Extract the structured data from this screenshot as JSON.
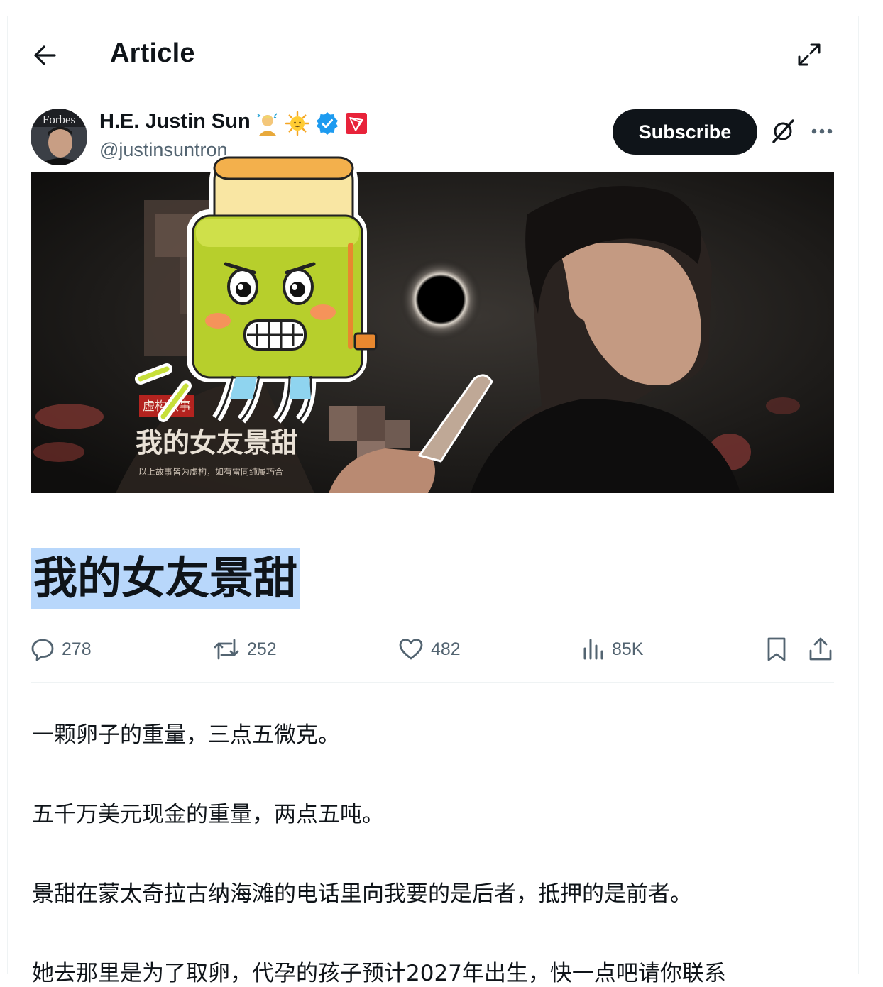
{
  "header": {
    "title": "Article"
  },
  "author": {
    "name": "H.E. Justin Sun",
    "handle": "@justinsuntron",
    "avatar_text": "Forbes"
  },
  "actions_top": {
    "subscribe_label": "Subscribe"
  },
  "hero_image": {
    "tag_text": "虚构故事",
    "cover_title": "我的女友景甜",
    "caption": "以上故事皆为虚构，如有雷同纯属巧合"
  },
  "article": {
    "title": "我的女友景甜",
    "paragraphs": [
      "一颗卵子的重量，三点五微克。",
      "五千万美元现金的重量，两点五吨。",
      "景甜在蒙太奇拉古纳海滩的电话里向我要的是后者，抵押的是前者。",
      "她去那里是为了取卵，代孕的孩子预计2027年出生，快一点吧请你联系"
    ]
  },
  "stats": {
    "replies": "278",
    "reposts": "252",
    "likes": "482",
    "views": "85K"
  },
  "colors": {
    "text": "#0f1419",
    "secondary": "#536471",
    "verified": "#1d9bf0",
    "highlight": "#b8d7fb",
    "tron_red": "#e8233a"
  }
}
